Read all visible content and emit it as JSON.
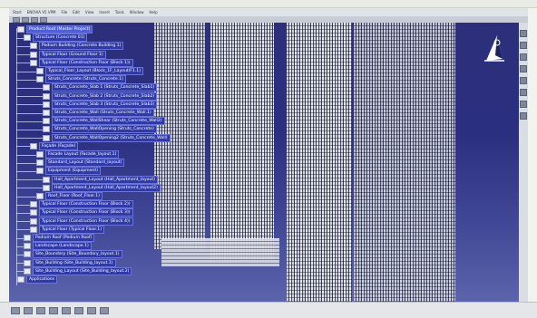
{
  "app": {
    "menu": [
      "Start",
      "ENOVIA V5 VPM",
      "File",
      "Edit",
      "View",
      "Insert",
      "Tools",
      "Window",
      "Help"
    ]
  },
  "tree": {
    "nodes": [
      {
        "label": "Product Root (Master Project)",
        "level": 0
      },
      {
        "label": "Structure (Concrete 01)",
        "level": 1
      },
      {
        "label": "Podium Building (Concrete Building 1)",
        "level": 2
      },
      {
        "label": "Typical Floor (Ground Floor 1)",
        "level": 2
      },
      {
        "label": "Typical Floor (Construction Floor (Block 1))",
        "level": 2
      },
      {
        "label": "Typical_Floor_Layout (Block_1F_Layout/F1.1)",
        "level": 3
      },
      {
        "label": "Struts_Concrete (Struts_Concrete.1)",
        "level": 3
      },
      {
        "label": "Struts_Concrete_Slab 1 (Struts_Concrete_Slab1)",
        "level": 4
      },
      {
        "label": "Struts_Concrete_Slab 2 (Struts_Concrete_Slab2)",
        "level": 4
      },
      {
        "label": "Struts_Concrete_Slab 3 (Struts_Concrete_Slab3)",
        "level": 4
      },
      {
        "label": "Struts_Concrete_Wall (Struts_Concrete_Wall.1)",
        "level": 4
      },
      {
        "label": "Struts_Concrete_WallShear (Struts_Concrete_Wall2)",
        "level": 4
      },
      {
        "label": "Struts_Concrete_WallOpening (Struts_Concrete)",
        "level": 4
      },
      {
        "label": "Struts_Concrete_WallOpening2 (Struts_Concrete_Wall)",
        "level": 4
      },
      {
        "label": "Façade (Façade)",
        "level": 2
      },
      {
        "label": "Facade Layout (Facade_layout.1)",
        "level": 3
      },
      {
        "label": "Standard_Layout (Standard_layout)",
        "level": 3
      },
      {
        "label": "Equipment (Equipment)",
        "level": 3
      },
      {
        "label": "Hall_Apartment_Layout (Hall_Apartment_layout)",
        "level": 4
      },
      {
        "label": "Hall_Apartment_Layout (Hall_Apartment_layout2)",
        "level": 4
      },
      {
        "label": "Roof_Floor (Roof_Floor.1)",
        "level": 3
      },
      {
        "label": "Typical Floor (Construction Floor (Block 2))",
        "level": 2
      },
      {
        "label": "Typical Floor (Construction Floor (Block 3))",
        "level": 2
      },
      {
        "label": "Typical Floor (Construction Floor (Block 4))",
        "level": 2
      },
      {
        "label": "Typical Floor (Typical Floor.1)",
        "level": 2
      },
      {
        "label": "Podium Roof (Podium Roof)",
        "level": 1
      },
      {
        "label": "Landscape (Landscape.1)",
        "level": 1
      },
      {
        "label": "Site_Boundary (Site_Boundary_layout.1)",
        "level": 1
      },
      {
        "label": "Site_Building (Site_Building_layout.1)",
        "level": 1
      },
      {
        "label": "Site_Building_Layout (Site_Building_layout.2)",
        "level": 1
      },
      {
        "label": "Applications",
        "level": 0
      }
    ]
  }
}
